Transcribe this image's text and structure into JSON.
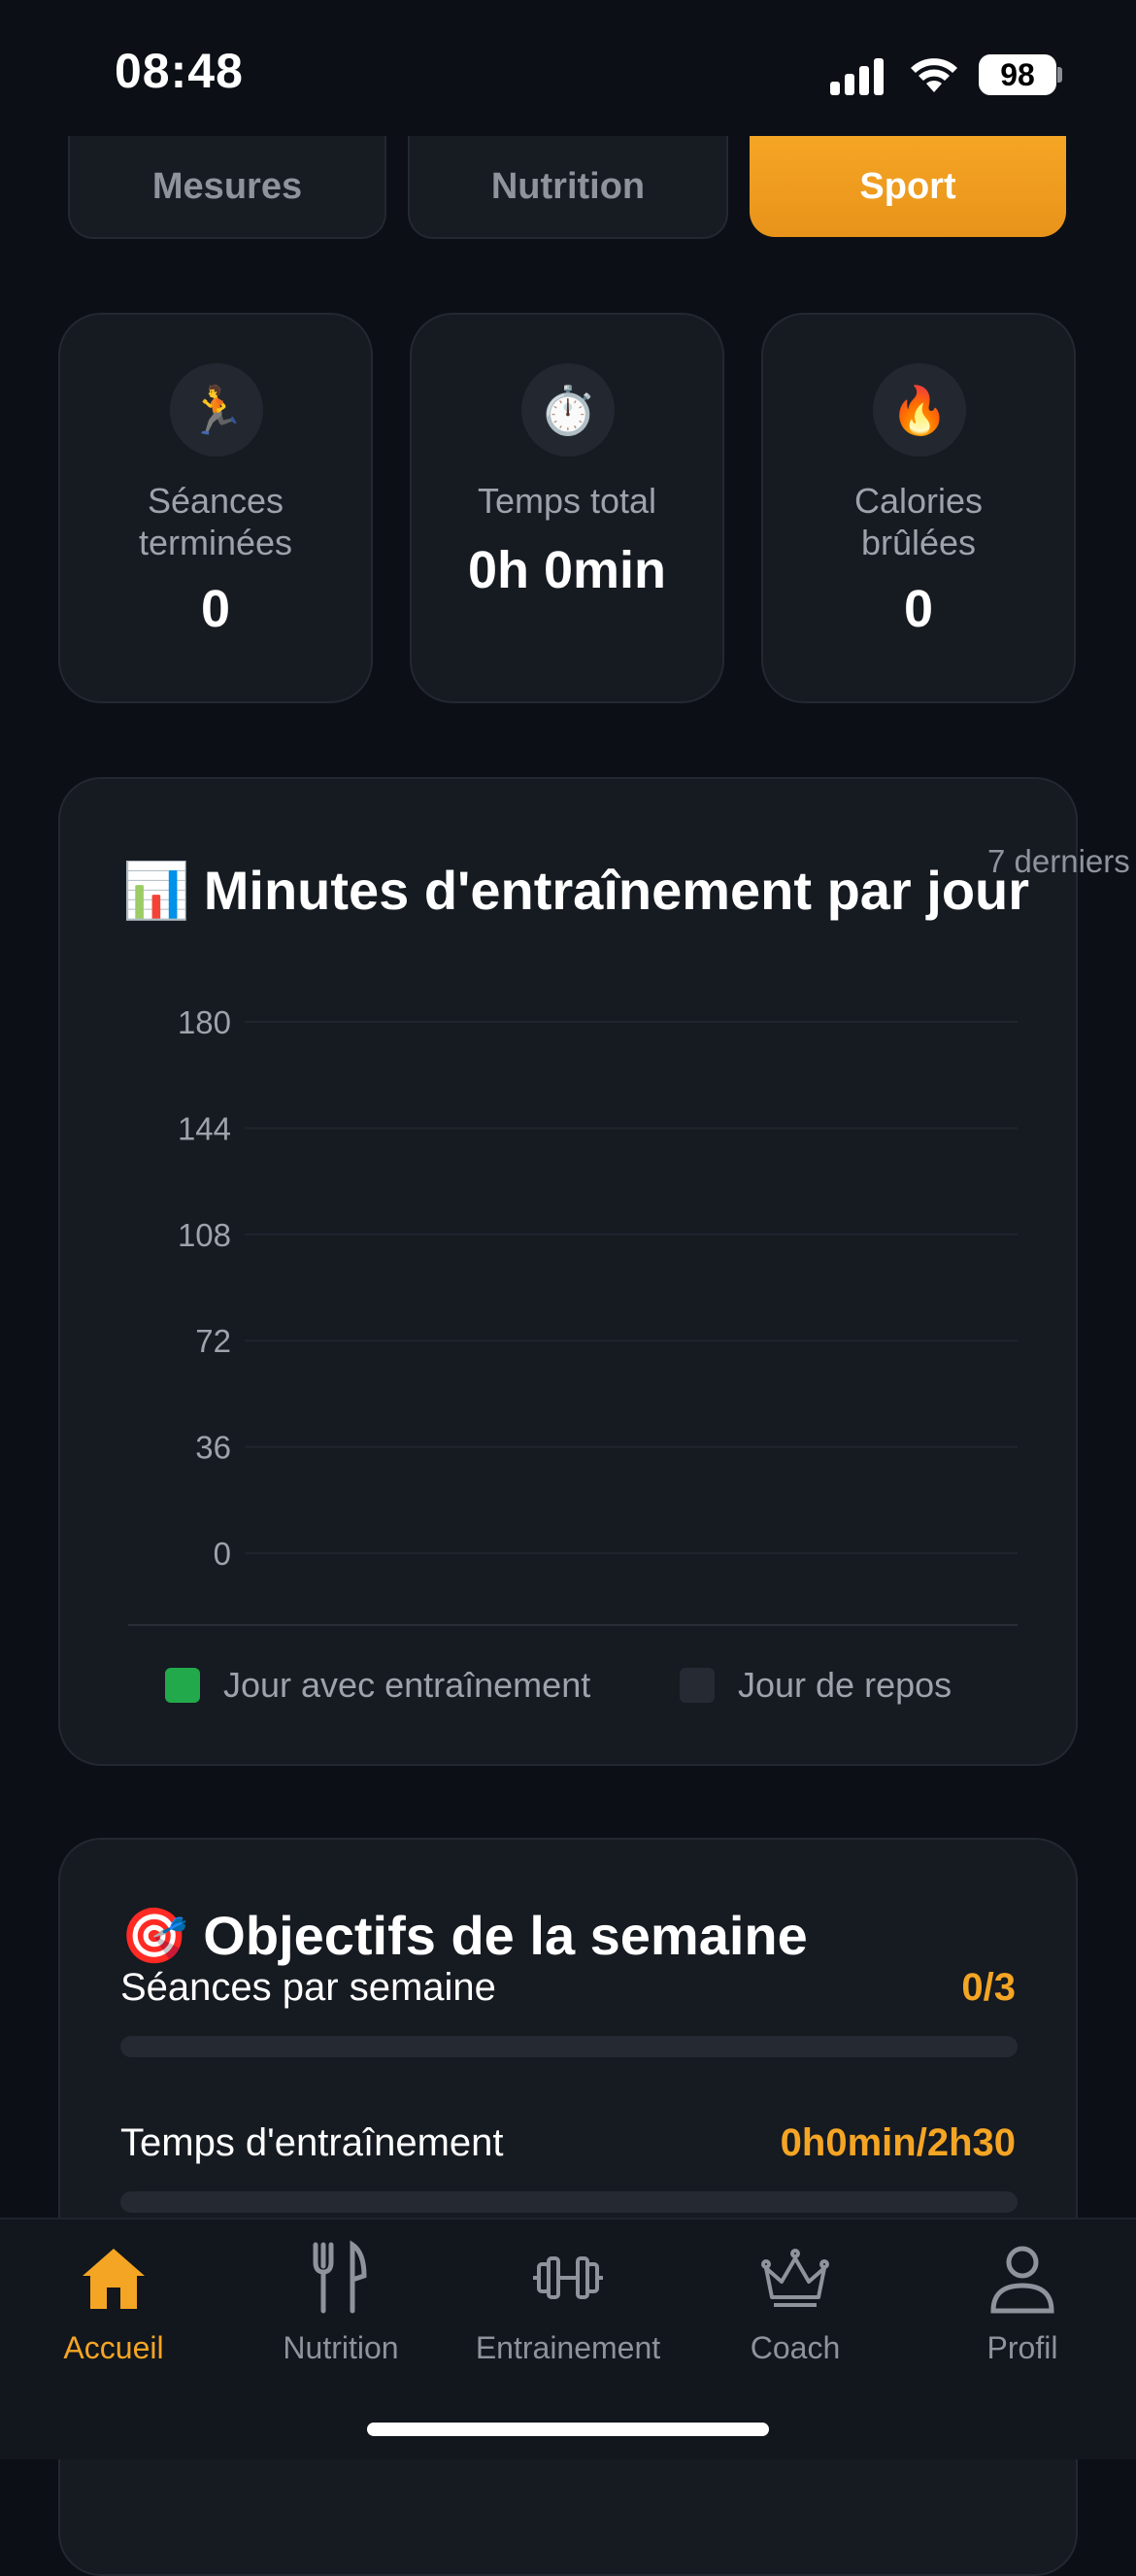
{
  "status_bar": {
    "time": "08:48",
    "battery": "98"
  },
  "tabs": [
    {
      "label": "Mesures",
      "active": false
    },
    {
      "label": "Nutrition",
      "active": false
    },
    {
      "label": "Sport",
      "active": true
    }
  ],
  "stats": [
    {
      "icon": "🏃",
      "icon_name": "runner-icon",
      "label_line1": "Séances",
      "label_line2": "terminées",
      "value": "0"
    },
    {
      "icon": "⏱️",
      "icon_name": "stopwatch-icon",
      "label_line1": "Temps total",
      "label_line2": "",
      "value": "0h 0min"
    },
    {
      "icon": "🔥",
      "icon_name": "fire-icon",
      "label_line1": "Calories",
      "label_line2": "brûlées",
      "value": "0"
    }
  ],
  "chart_section": {
    "emoji": "📊",
    "title": "Minutes d'entraînement par jour",
    "range": "7 derniers",
    "legend": [
      {
        "label": "Jour avec entraînement",
        "color": "#22a94b"
      },
      {
        "label": "Jour de repos",
        "color": "#262b33"
      }
    ]
  },
  "chart_data": {
    "type": "bar",
    "title": "Minutes d'entraînement par jour",
    "xlabel": "",
    "ylabel": "",
    "ylim": [
      0,
      180
    ],
    "yticks": [
      180,
      144,
      108,
      72,
      36,
      0
    ],
    "categories": [],
    "values": [],
    "grid": true,
    "legend_position": "bottom"
  },
  "goals": {
    "emoji": "🎯",
    "title": "Objectifs de la semaine",
    "items": [
      {
        "label": "Séances par semaine",
        "value": "0/3",
        "progress": 0
      },
      {
        "label": "Temps d'entraînement",
        "value": "0h0min/2h30",
        "progress": 0
      }
    ]
  },
  "nav": [
    {
      "label": "Accueil",
      "icon_name": "home-icon",
      "active": true
    },
    {
      "label": "Nutrition",
      "icon_name": "fork-knife-icon",
      "active": false
    },
    {
      "label": "Entrainement",
      "icon_name": "dumbbell-icon",
      "active": false
    },
    {
      "label": "Coach",
      "icon_name": "crown-icon",
      "active": false
    },
    {
      "label": "Profil",
      "icon_name": "user-icon",
      "active": false
    }
  ],
  "colors": {
    "accent": "#f5a524",
    "background": "#0c1016",
    "card": "#161a21",
    "training": "#22a94b"
  }
}
